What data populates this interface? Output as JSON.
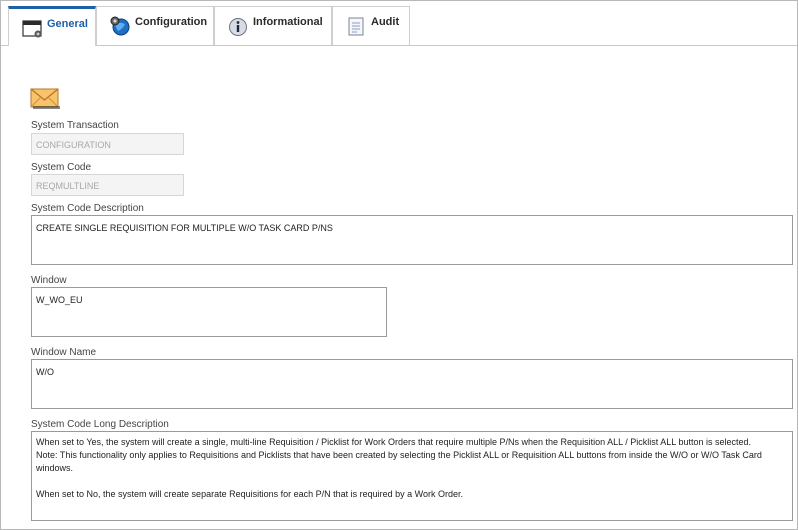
{
  "tabs": [
    {
      "label": "General",
      "icon": "window-icon",
      "active": true
    },
    {
      "label": "Configuration",
      "icon": "gear-globe-icon",
      "active": false
    },
    {
      "label": "Informational",
      "icon": "info-icon",
      "active": false
    },
    {
      "label": "Audit",
      "icon": "notepad-icon",
      "active": false
    }
  ],
  "form": {
    "system_transaction_label": "System Transaction",
    "system_transaction_value": "CONFIGURATION",
    "system_code_label": "System Code",
    "system_code_value": "REQMULTLINE",
    "system_code_description_label": "System Code Description",
    "system_code_description_value": "CREATE SINGLE REQUISITION FOR MULTIPLE W/O TASK CARD P/NS",
    "window_label": "Window",
    "window_value": "W_WO_EU",
    "window_name_label": "Window Name",
    "window_name_value": "W/O",
    "long_description_label": "System Code Long Description",
    "long_description_lines": [
      "When set to Yes, the system will create a single, multi-line Requisition / Picklist for Work Orders that require multiple P/Ns when the Requisition ALL / Picklist ALL button is selected.",
      "Note: This functionality only applies to Requisitions and Picklists that have been created by selecting the Picklist ALL or Requisition ALL buttons from inside the W/O or W/O Task Card windows.",
      "",
      "When set to No, the system will create separate Requisitions for each P/N that is required by a Work Order."
    ]
  },
  "colors": {
    "active_tab_accent": "#1f5fa8",
    "envelope": "#e8a23a"
  }
}
